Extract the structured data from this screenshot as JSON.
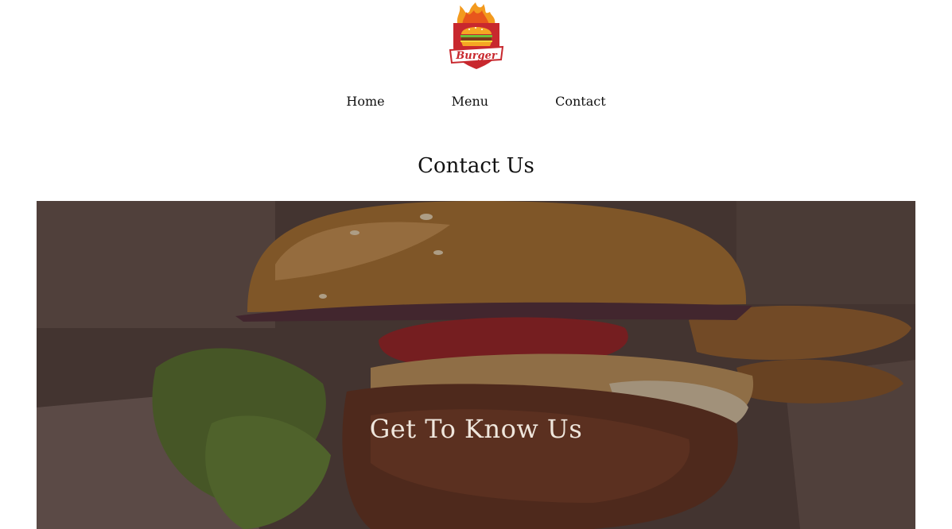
{
  "logo": {
    "text": "Burger",
    "icon": "burger-flame-logo"
  },
  "nav": {
    "items": [
      {
        "label": "Home"
      },
      {
        "label": "Menu"
      },
      {
        "label": "Contact"
      }
    ]
  },
  "page": {
    "title": "Contact Us"
  },
  "hero": {
    "title": "Get To Know Us",
    "image": "burger-photo"
  },
  "colors": {
    "logo_red": "#c8282e",
    "logo_orange": "#f39a1e",
    "overlay": "#3a2a28"
  }
}
